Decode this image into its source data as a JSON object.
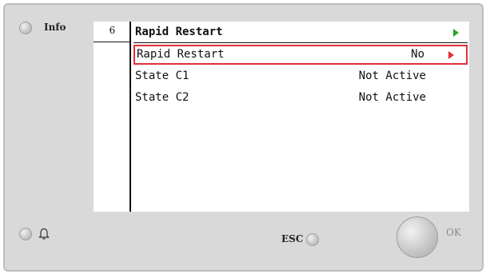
{
  "device": {
    "info_label": "Info",
    "esc_label": "ESC",
    "ok_label": "OK"
  },
  "screen": {
    "page_number": "6",
    "header": {
      "label": "Rapid Restart",
      "arrow_color": "#2aa52a"
    },
    "rows": [
      {
        "label": "Rapid Restart",
        "value": "No",
        "selected": true,
        "arrow_color": "#e0303a"
      },
      {
        "label": "State C1",
        "value": "Not Active"
      },
      {
        "label": "State C2",
        "value": "Not Active"
      }
    ]
  },
  "icons": {
    "bell": "bell-icon",
    "nav_arrow": "triangle-right-icon"
  },
  "colors": {
    "selection": "#e0303a",
    "header_arrow": "#2aa52a",
    "bezel": "#d9d9d9"
  }
}
